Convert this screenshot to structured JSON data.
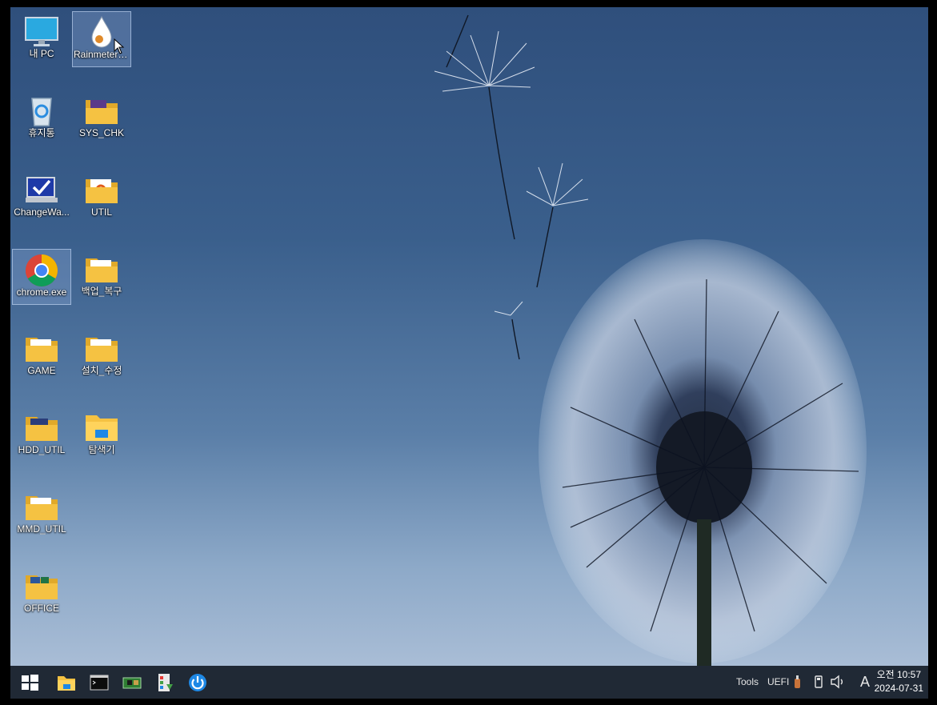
{
  "desktop": {
    "icons": [
      {
        "label": "내 PC",
        "icon": "monitor-icon",
        "selected": false
      },
      {
        "label": "Rainmeter_...",
        "icon": "rainmeter-drop-icon",
        "selected": true
      },
      {
        "label": "휴지통",
        "icon": "recycle-bin-icon",
        "selected": false
      },
      {
        "label": "SYS_CHK",
        "icon": "folder-icon",
        "selected": false
      },
      {
        "label": "ChangeWa...",
        "icon": "computer-check-icon",
        "selected": false
      },
      {
        "label": "UTIL",
        "icon": "folder-icon",
        "selected": false
      },
      {
        "label": "chrome.exe",
        "icon": "chrome-icon",
        "selected": true
      },
      {
        "label": "백업_복구",
        "icon": "folder-icon",
        "selected": false
      },
      {
        "label": "GAME",
        "icon": "folder-icon",
        "selected": false
      },
      {
        "label": "설치_수정",
        "icon": "folder-icon",
        "selected": false
      },
      {
        "label": "HDD_UTIL",
        "icon": "folder-icon",
        "selected": false
      },
      {
        "label": "탐색기",
        "icon": "file-explorer-icon",
        "selected": false
      },
      {
        "label": "MMD_UTIL",
        "icon": "folder-icon",
        "selected": false
      },
      {
        "label": "OFFICE",
        "icon": "folder-icon",
        "selected": false
      }
    ]
  },
  "taskbar": {
    "buttons": [
      {
        "name": "start-button",
        "icon": "windows-logo-icon"
      },
      {
        "name": "file-explorer-button",
        "icon": "file-explorer-icon"
      },
      {
        "name": "command-prompt-button",
        "icon": "command-prompt-icon"
      },
      {
        "name": "hardware-info-button",
        "icon": "circuit-board-icon"
      },
      {
        "name": "app-installer-button",
        "icon": "installer-icon"
      },
      {
        "name": "power-button",
        "icon": "power-icon"
      }
    ],
    "tray": {
      "tools_label": "Tools",
      "uefi_label": "UEFI",
      "ime_label": "A",
      "clock_time": "오전 10:57",
      "clock_date": "2024-07-31"
    }
  },
  "colors": {
    "taskbar": "#232d3a",
    "folder": "#f5c242",
    "accent": "#0078d7"
  }
}
